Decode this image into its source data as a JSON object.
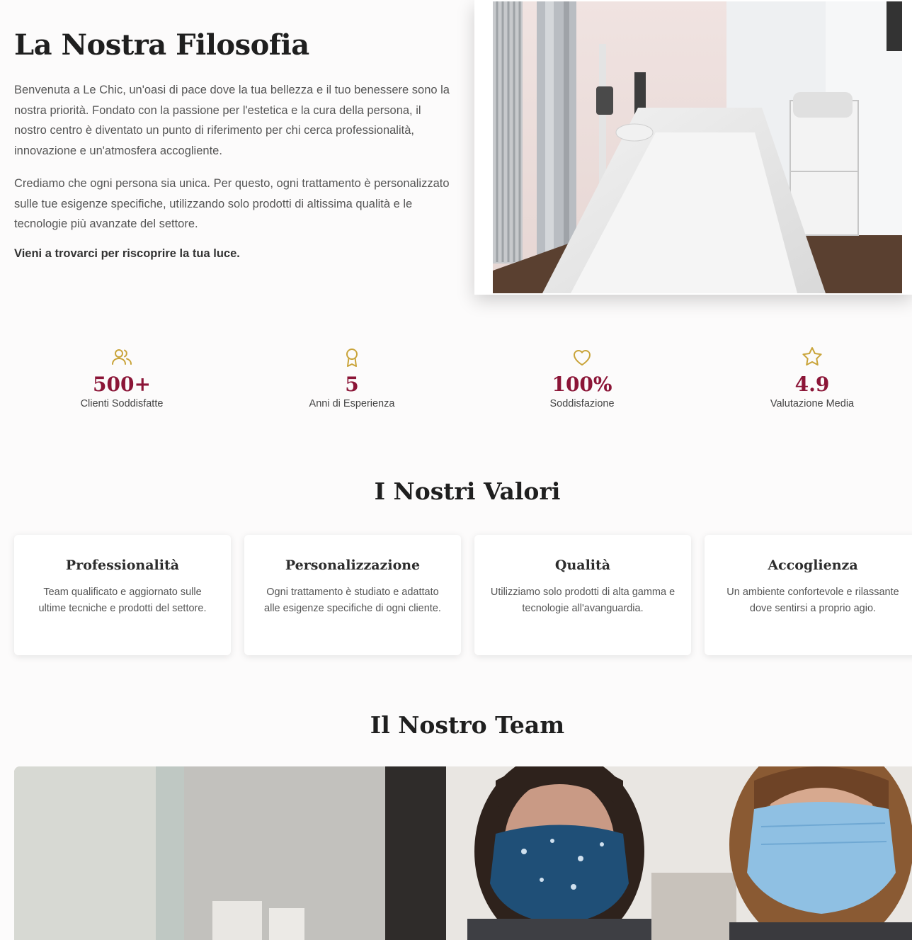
{
  "philosophy": {
    "title": "La Nostra Filosofia",
    "paragraph_1": "Benvenuta a Le Chic, un'oasi di pace dove la tua bellezza e il tuo benessere sono la nostra priorità. Fondato con la passione per l'estetica e la cura della persona, il nostro centro è diventato un punto di riferimento per chi cerca professionalità, innovazione e un'atmosfera accogliente.",
    "paragraph_2": "Crediamo che ogni persona sia unica. Per questo, ogni trattamento è personalizzato sulle tue esigenze specifiche, utilizzando solo prodotti di altissima qualità e le tecnologie più avanzate del settore.",
    "closing": "Vieni a trovarci per riscoprire la tua luce."
  },
  "stats": [
    {
      "icon": "users-icon",
      "value": "500+",
      "label": "Clienti Soddisfatte"
    },
    {
      "icon": "award-icon",
      "value": "5",
      "label": "Anni di Esperienza"
    },
    {
      "icon": "heart-icon",
      "value": "100%",
      "label": "Soddisfazione"
    },
    {
      "icon": "star-icon",
      "value": "4.9",
      "label": "Valutazione Media"
    }
  ],
  "values": {
    "title": "I Nostri Valori",
    "cards": [
      {
        "title": "Professionalità",
        "text": "Team qualificato e aggiornato sulle ultime tecniche e prodotti del settore."
      },
      {
        "title": "Personalizzazione",
        "text": "Ogni trattamento è studiato e adattato alle esigenze specifiche di ogni cliente."
      },
      {
        "title": "Qualità",
        "text": "Utilizziamo solo prodotti di alta gamma e tecnologie all'avanguardia."
      },
      {
        "title": "Accoglienza",
        "text": "Un ambiente confortevole e rilassante dove sentirsi a proprio agio."
      }
    ]
  },
  "team": {
    "title": "Il Nostro Team"
  },
  "colors": {
    "accent": "#8b1537",
    "icon_gold": "#c9a43a",
    "background": "#fcfbfb"
  }
}
